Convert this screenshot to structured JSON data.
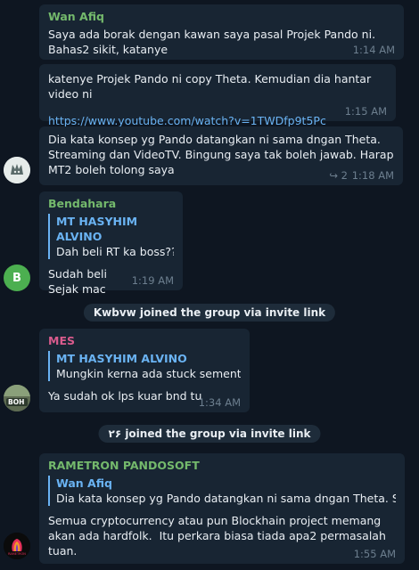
{
  "messages": [
    {
      "sender": "Wan Afiq",
      "sender_color": "#74b96c",
      "text": "Saya ada borak dengan kawan saya pasal Projek Pando ni. Bahas2 sikit, katanye",
      "time": "1:14 AM"
    },
    {
      "text": "katenye Projek Pando ni copy Theta. Kemudian dia hantar video ni",
      "link": "https://www.youtube.com/watch?v=1TWDfp9t5Pc",
      "time": "1:15 AM"
    },
    {
      "text": "Dia kata konsep yg Pando datangkan ni sama dngan Theta. Streaming dan VideoTV. Bingung saya tak boleh jawab. Harap MT2 boleh tolong saya",
      "replies_icon": "reply-arrow-icon",
      "replies_count": "2",
      "time": "1:18 AM",
      "avatar_icon": "fox-logo-icon"
    },
    {
      "sender": "Bendahara",
      "sender_color": "#74b96c",
      "reply_to": {
        "name": "MT HASYHIM ALVINO",
        "text": "Dah beli RT ka boss??"
      },
      "text": "Sudah beli\nSejak mac",
      "time": "1:19 AM",
      "avatar_letter": "B",
      "avatar_color": "#4caf50"
    },
    {
      "sender": "MES",
      "sender_color": "#d95b8d",
      "reply_to": {
        "name": "MT HASYHIM ALVINO",
        "text": "Mungkin kerna ada  stuck sement..."
      },
      "text": "Ya sudah ok lps kuar bnd tu",
      "time": "1:34 AM",
      "avatar_label": "BOH"
    },
    {
      "sender": "RAMETRON PANDOSOFT",
      "sender_color": "#74b96c",
      "reply_to": {
        "name": "Wan Afiq",
        "text": "Dia kata konsep yg Pando datangkan ni sama dngan Theta. Strea..."
      },
      "text": "Semua cryptocurrency atau pun Blockhain project memang akan ada hardfolk.  Itu perkara biasa tiada apa2 permasalah tuan.",
      "time": "1:55 AM",
      "avatar_label": "RAMETRON"
    }
  ],
  "service": [
    "Kwbvw joined the group via invite link",
    "۲۶ joined the group via invite link"
  ]
}
